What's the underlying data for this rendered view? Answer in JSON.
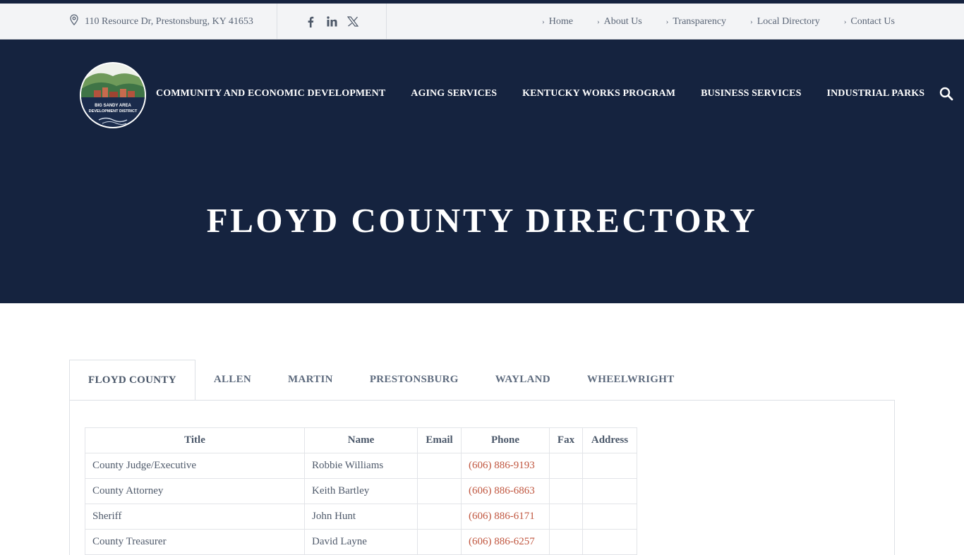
{
  "topbar": {
    "address": "110 Resource Dr, Prestonsburg, KY 41653",
    "social": [
      {
        "icon": "facebook-icon"
      },
      {
        "icon": "linkedin-icon"
      },
      {
        "icon": "x-twitter-icon"
      }
    ],
    "links": [
      "Home",
      "About Us",
      "Transparency",
      "Local Directory",
      "Contact Us"
    ]
  },
  "header": {
    "logo": {
      "line1": "BIG SANDY AREA",
      "line2": "DEVELOPMENT DISTRICT"
    },
    "nav": [
      "COMMUNITY AND ECONOMIC DEVELOPMENT",
      "AGING SERVICES",
      "KENTUCKY WORKS PROGRAM",
      "BUSINESS SERVICES",
      "INDUSTRIAL PARKS"
    ],
    "search_icon": "search-icon",
    "page_title": "FLOYD COUNTY DIRECTORY"
  },
  "tabs": [
    "FLOYD COUNTY",
    "ALLEN",
    "MARTIN",
    "PRESTONSBURG",
    "WAYLAND",
    "WHEELWRIGHT"
  ],
  "active_tab": "FLOYD COUNTY",
  "directory": {
    "columns": [
      "Title",
      "Name",
      "Email",
      "Phone",
      "Fax",
      "Address"
    ],
    "rows": [
      {
        "title": "County Judge/Executive",
        "name": "Robbie Williams",
        "email": "",
        "phone": "(606) 886-9193",
        "fax": "",
        "address": ""
      },
      {
        "title": "County Attorney",
        "name": "Keith Bartley",
        "email": "",
        "phone": "(606) 886-6863",
        "fax": "",
        "address": ""
      },
      {
        "title": "Sheriff",
        "name": "John Hunt",
        "email": "",
        "phone": "(606) 886-6171",
        "fax": "",
        "address": ""
      },
      {
        "title": "County Treasurer",
        "name": "David Layne",
        "email": "",
        "phone": "(606) 886-6257",
        "fax": "",
        "address": ""
      }
    ]
  },
  "colors": {
    "navy": "#15233f",
    "topbar_bg": "#f3f4f6",
    "link_accent": "#c0563f"
  }
}
